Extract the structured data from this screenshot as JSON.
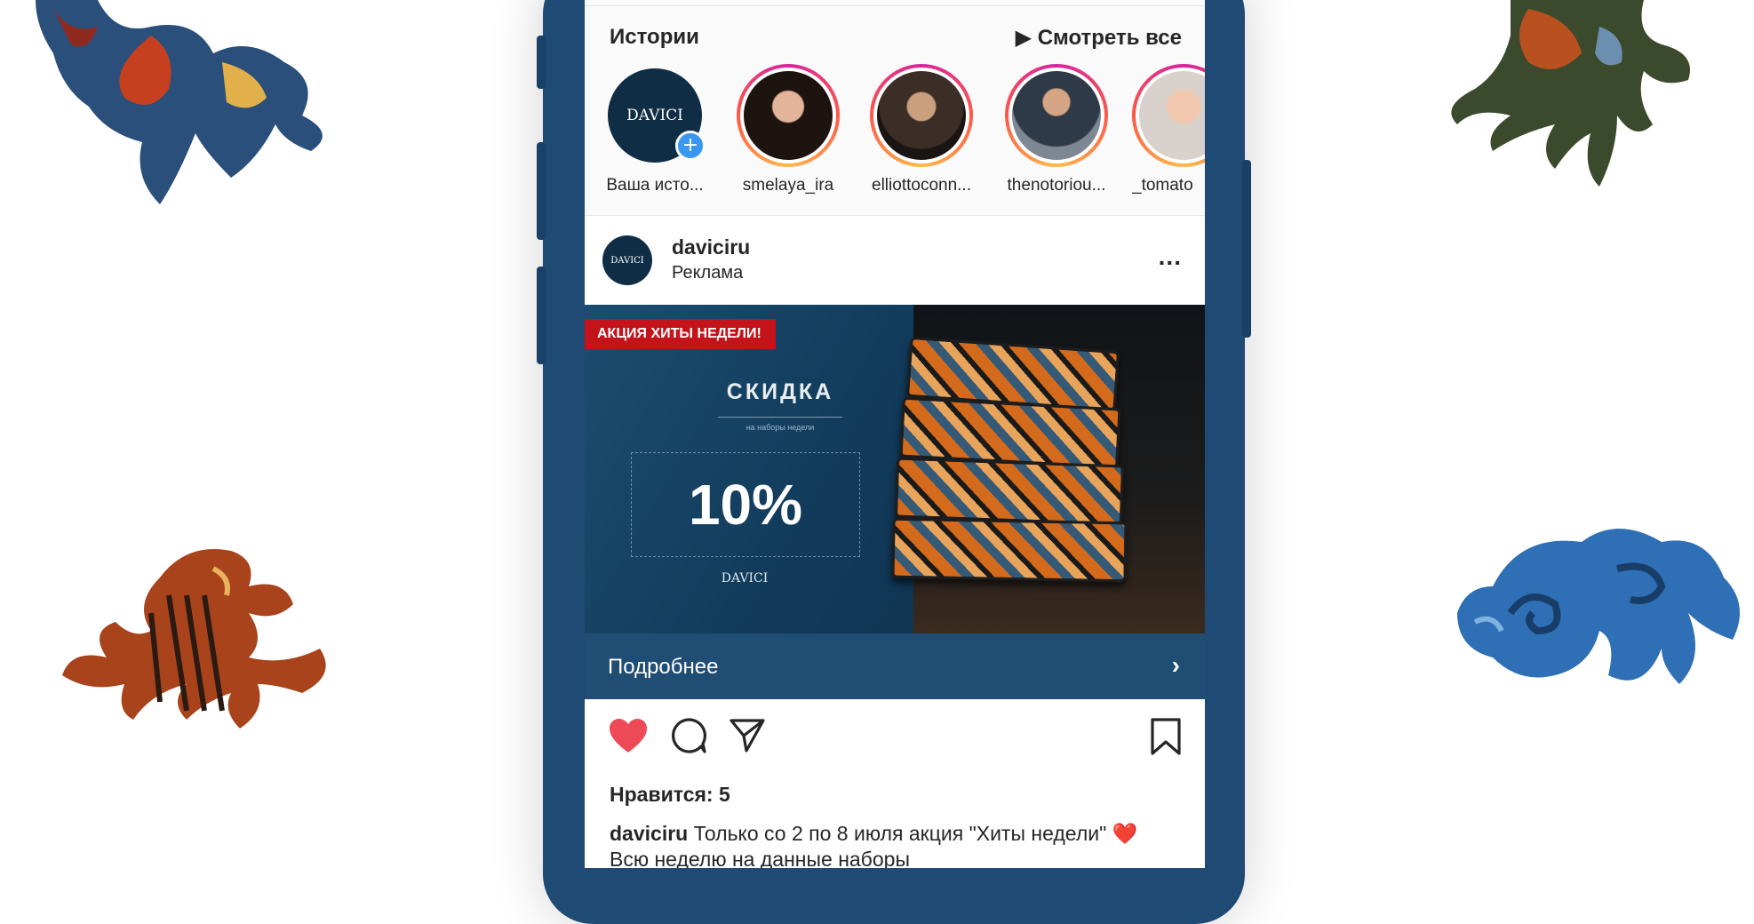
{
  "colors": {
    "phone_body": "#1e4a73",
    "like_red": "#ed4956",
    "ad_badge_red": "#c4131a",
    "accent_blue": "#3897f0"
  },
  "stories": {
    "title": "Истории",
    "watch_all": "▶ Смотреть все",
    "items": [
      {
        "label": "Ваша исто...",
        "own": true,
        "avatar_text": "DAVICI"
      },
      {
        "label": "smelaya_ira"
      },
      {
        "label": "elliottoconn..."
      },
      {
        "label": "thenotoriou..."
      },
      {
        "label": "_tomato"
      }
    ]
  },
  "post": {
    "username": "daviciru",
    "sponsored": "Реклама",
    "avatar_text": "DAVICI",
    "more_icon": "...",
    "ad": {
      "badge": "АКЦИЯ ХИТЫ НЕДЕЛИ!",
      "discount_label": "СКИДКА",
      "small_text": "на наборы недели",
      "percent": "10%",
      "logo_text": "DAVICI"
    },
    "more_link": "Подробнее",
    "more_chevron": "›",
    "likes": "Нравится: 5",
    "caption_user": "daviciru",
    "caption_text": " Только со 2 по 8 июля акция \"Хиты недели\" ❤️ Всю неделю на данные наборы"
  },
  "icons": [
    "heart-icon",
    "comment-icon",
    "share-icon",
    "bookmark-icon"
  ]
}
